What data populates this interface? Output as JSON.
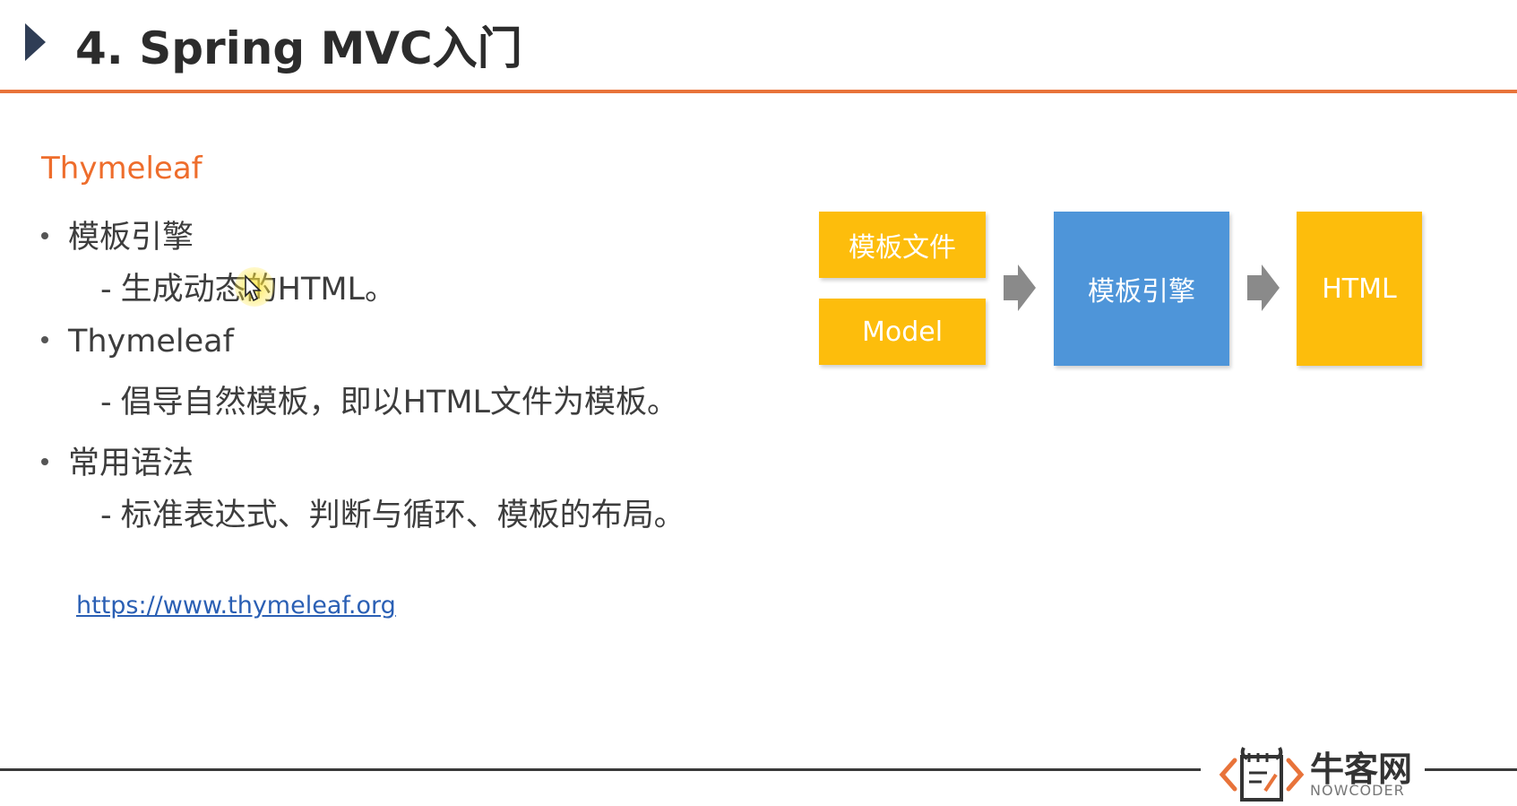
{
  "header": {
    "title": "4. Spring MVC入门"
  },
  "content": {
    "section_label": "Thymeleaf",
    "bullets": [
      {
        "label": "模板引擎",
        "sub": "生成动态的HTML。"
      },
      {
        "label": "Thymeleaf",
        "sub": "倡导自然模板，即以HTML文件为模板。"
      },
      {
        "label": "常用语法",
        "sub": "标准表达式、判断与循环、模板的布局。"
      }
    ],
    "sub_prefix": "-",
    "link": "https://www.thymeleaf.org"
  },
  "diagram": {
    "template_file": "模板文件",
    "model": "Model",
    "engine": "模板引擎",
    "output": "HTML",
    "colors": {
      "yellow": "#fdbd0c",
      "blue": "#4e95d9",
      "arrow": "#8a8a8a"
    }
  },
  "footer": {
    "logo_cn": "牛客网",
    "logo_en": "NOWCODER"
  },
  "colors": {
    "accent": "#ee6d2c",
    "rule": "#e8733a",
    "link": "#2a5fb4"
  }
}
